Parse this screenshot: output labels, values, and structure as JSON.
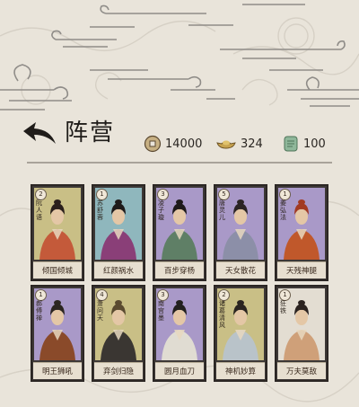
{
  "header": {
    "title": "阵营"
  },
  "resources": {
    "coins": {
      "icon": "copper-coin-icon",
      "amount": "14000"
    },
    "ingots": {
      "icon": "gold-ingot-icon",
      "amount": "324"
    },
    "jade": {
      "icon": "jade-token-icon",
      "amount": "100"
    }
  },
  "heroes": [
    {
      "name": "阮人语",
      "star": "2",
      "skill": "倾国倾城",
      "bg": "#c9bf86"
    },
    {
      "name": "苏舒蓉",
      "star": "1",
      "skill": "红颜祸水",
      "bg": "#8fb7bd"
    },
    {
      "name": "凌子璇",
      "star": "3",
      "skill": "百步穿杨",
      "bg": "#a999c8"
    },
    {
      "name": "唐灵儿",
      "star": "5",
      "skill": "天女散花",
      "bg": "#a999c8"
    },
    {
      "name": "姜弘法",
      "star": "1",
      "skill": "天残神腿",
      "bg": "#a999c8"
    },
    {
      "name": "郝傅禅",
      "star": "1",
      "skill": "明王狮吼",
      "bg": "#a999c8"
    },
    {
      "name": "萧问天",
      "star": "4",
      "skill": "弃剑归隐",
      "bg": "#c9bf86"
    },
    {
      "name": "南宫墨",
      "star": "3",
      "skill": "圆月血刀",
      "bg": "#a999c8"
    },
    {
      "name": "诸葛清风",
      "star": "2",
      "skill": "神机妙算",
      "bg": "#c9bf86"
    },
    {
      "name": "狂铁",
      "star": "1",
      "skill": "万夫莫敌",
      "bg": "#e3ddd2"
    }
  ],
  "colors": {
    "background": "#e9e4da",
    "cardFrame": "#2c2724",
    "namePlate": "#e7dfd0"
  }
}
